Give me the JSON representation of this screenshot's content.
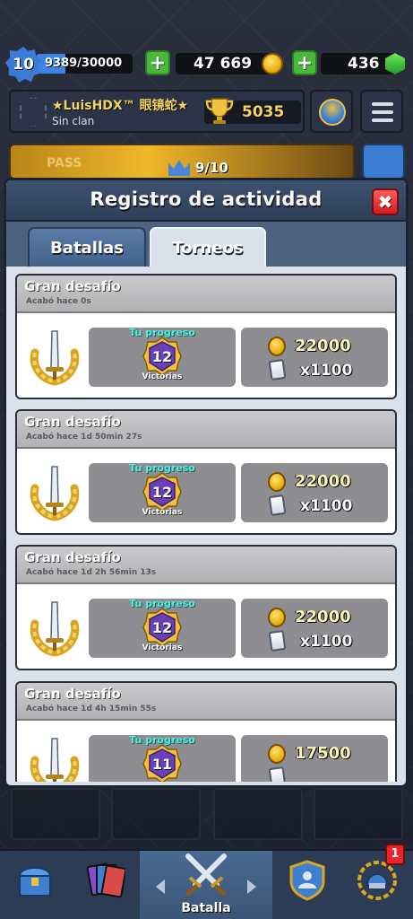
{
  "hud": {
    "level": "10",
    "xp_text": "9389/30000",
    "xp_fraction": 0.31,
    "gold": "47 669",
    "gems": "436",
    "plus_label": "+"
  },
  "player": {
    "name": "★LuisHDX™ 眼镜蛇★",
    "clan": "Sin clan",
    "trophies": "5035"
  },
  "pass": {
    "label": "PASS",
    "count": "9/10"
  },
  "modal": {
    "title": "Registro de actividad",
    "close_label": "✖",
    "tabs": [
      {
        "label": "Batallas",
        "active": false
      },
      {
        "label": "Torneos",
        "active": true
      }
    ]
  },
  "entries": [
    {
      "title": "Gran desafío",
      "subtitle": "Acabó hace 0s",
      "progress_label": "Tu progreso",
      "wins": "12",
      "wins_label": "Victorias",
      "gold": "22000",
      "cards": "x1100"
    },
    {
      "title": "Gran desafío",
      "subtitle": "Acabó hace 1d 50min  27s",
      "progress_label": "Tu progreso",
      "wins": "12",
      "wins_label": "Victorias",
      "gold": "22000",
      "cards": "x1100"
    },
    {
      "title": "Gran desafío",
      "subtitle": "Acabó hace 1d 2h 56min  13s",
      "progress_label": "Tu progreso",
      "wins": "12",
      "wins_label": "Victorias",
      "gold": "22000",
      "cards": "x1100"
    },
    {
      "title": "Gran desafío",
      "subtitle": "Acabó hace 1d 4h 15min  55s",
      "progress_label": "Tu progreso",
      "wins": "11",
      "wins_label": "",
      "gold": "17500",
      "cards": ""
    }
  ],
  "nav": {
    "items": [
      {
        "name": "shop",
        "label": ""
      },
      {
        "name": "cards",
        "label": ""
      },
      {
        "name": "battle",
        "label": "Batalla"
      },
      {
        "name": "clan",
        "label": ""
      },
      {
        "name": "tournaments",
        "label": ""
      }
    ],
    "notification_count": "1"
  },
  "colors": {
    "accent_blue": "#3c85e5",
    "progress_cyan": "#4ff0e0",
    "close_red": "#d01f1f",
    "trophy_gold": "#f4d45a"
  }
}
